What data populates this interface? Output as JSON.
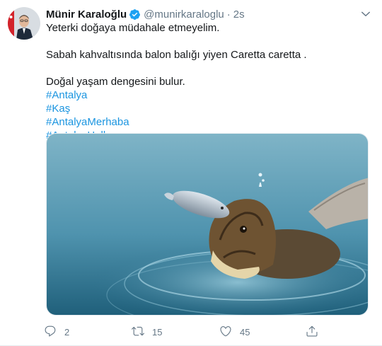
{
  "tweet": {
    "author_name": "Münir Karaloğlu",
    "handle": "@munirkaraloglu",
    "separator": "·",
    "time": "2s",
    "lines": [
      "Yeterki  doğaya müdahale etmeyelim.",
      "Sabah kahvaltısında balon balığı yiyen Caretta caretta .",
      "Doğal yaşam dengesini bulur."
    ],
    "hashtags": [
      "#Antalya",
      "#Kaş",
      "#AntalyaMerhaba",
      "#AntalyaHello"
    ],
    "media": {
      "icon": "turtle-photo"
    },
    "actions": {
      "reply_count": "2",
      "retweet_count": "15",
      "like_count": "45"
    }
  },
  "colors": {
    "link": "#1b95e0",
    "muted": "#657786",
    "verified": "#1da1f2",
    "text": "#14171a"
  }
}
